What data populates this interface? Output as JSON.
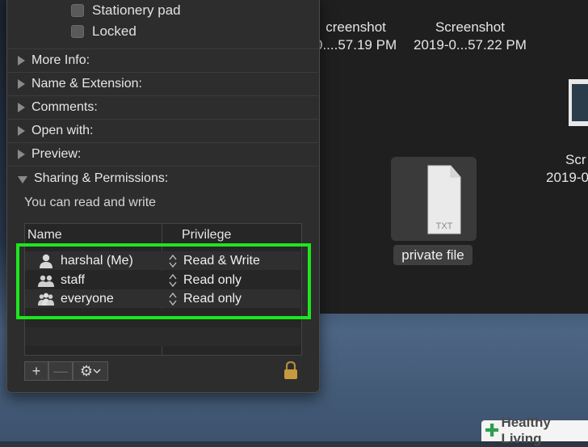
{
  "desktop": {
    "files": [
      {
        "line1": "creenshot",
        "line2": "0....57.19 PM"
      },
      {
        "line1": "Screenshot",
        "line2": "2019-0...57.22 PM"
      },
      {
        "line1": "Scr",
        "line2": "2019-0"
      }
    ],
    "private_file": {
      "label": "private file",
      "icon_text": "TXT"
    }
  },
  "info": {
    "checkboxes": [
      {
        "label": "Stationery pad",
        "checked": false
      },
      {
        "label": "Locked",
        "checked": false
      }
    ],
    "sections": [
      {
        "label": "More Info:",
        "expanded": false
      },
      {
        "label": "Name & Extension:",
        "expanded": false
      },
      {
        "label": "Comments:",
        "expanded": false
      },
      {
        "label": "Open with:",
        "expanded": false
      },
      {
        "label": "Preview:",
        "expanded": false
      },
      {
        "label": "Sharing & Permissions:",
        "expanded": true
      }
    ],
    "permission_note": "You can read and write",
    "table": {
      "headers": {
        "name": "Name",
        "privilege": "Privilege"
      },
      "rows": [
        {
          "name": "harshal (Me)",
          "privilege": "Read & Write",
          "icon": "single-user-icon"
        },
        {
          "name": "staff",
          "privilege": "Read only",
          "icon": "group-icon"
        },
        {
          "name": "everyone",
          "privilege": "Read only",
          "icon": "everyone-icon"
        }
      ]
    },
    "toolbar": {
      "add": "+",
      "remove": "—",
      "gear_label": "⚙"
    }
  },
  "watermark": {
    "brand": "Healthy Living"
  },
  "colors": {
    "highlight": "#1ee61e",
    "panel": "#2d2d2d"
  }
}
